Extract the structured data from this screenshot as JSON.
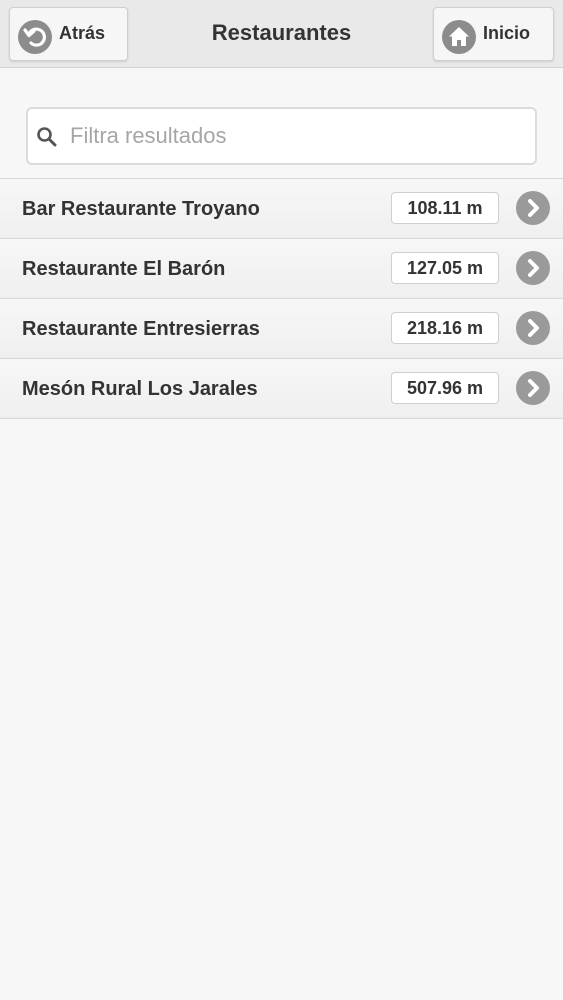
{
  "header": {
    "title": "Restaurantes",
    "back_label": "Atrás",
    "home_label": "Inicio"
  },
  "search": {
    "placeholder": "Filtra resultados",
    "value": ""
  },
  "restaurants": [
    {
      "name": "Bar Restaurante Troyano",
      "distance": "108.11 m"
    },
    {
      "name": "Restaurante El Barón",
      "distance": "127.05 m"
    },
    {
      "name": "Restaurante Entresierras",
      "distance": "218.16 m"
    },
    {
      "name": "Mesón Rural Los Jarales",
      "distance": "507.96 m"
    }
  ],
  "icons": {
    "back": "back-arrow-icon",
    "home": "home-icon",
    "search": "search-icon",
    "row_arrow": "chevron-right-icon"
  },
  "colors": {
    "header_bg": "#e9e9e9",
    "page_bg": "#f8f7f8",
    "icon_gray": "#8c8c8c",
    "text": "#333333"
  }
}
